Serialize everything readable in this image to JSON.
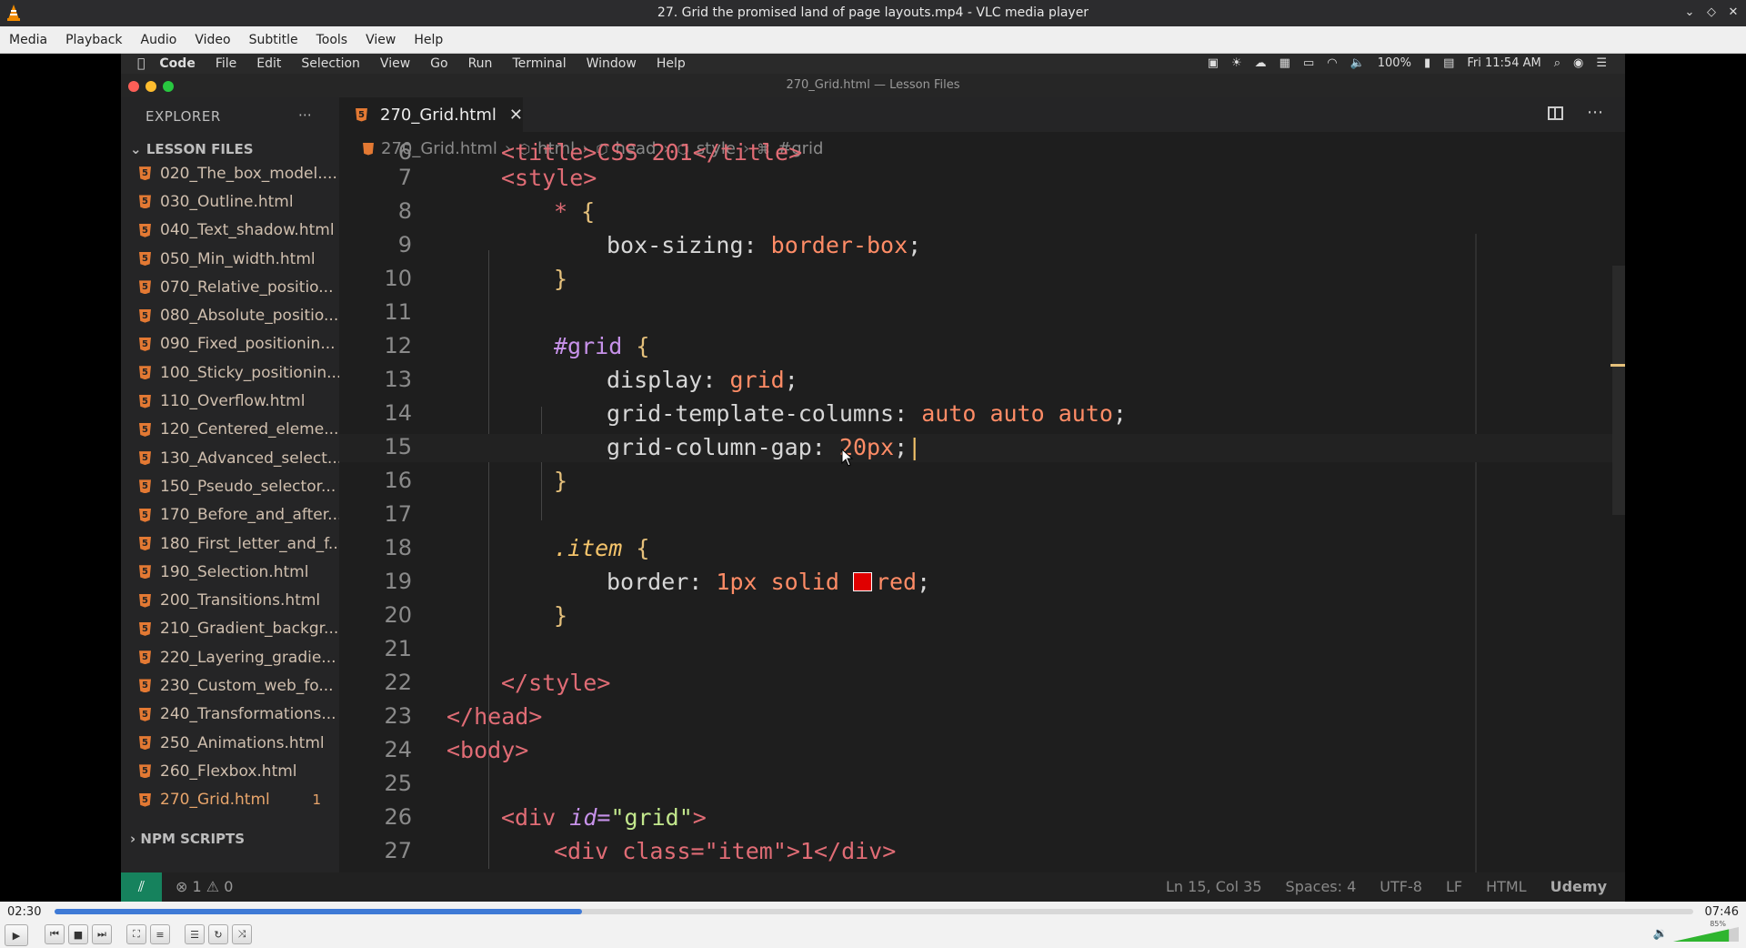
{
  "window": {
    "title": "27. Grid the promised land of page layouts.mp4 - VLC media player",
    "buttons": [
      "minimize",
      "restore",
      "close"
    ]
  },
  "vlc_menu": [
    "Media",
    "Playback",
    "Audio",
    "Video",
    "Subtitle",
    "Tools",
    "View",
    "Help"
  ],
  "player": {
    "elapsed": "02:30",
    "total": "07:46",
    "progress_fraction": 0.322,
    "volume_label": "85%",
    "volume_fraction": 0.85
  },
  "video": {
    "mac_menu": [
      "Code",
      "File",
      "Edit",
      "Selection",
      "View",
      "Go",
      "Run",
      "Terminal",
      "Window",
      "Help"
    ],
    "mac_status": {
      "battery": "100%",
      "clock": "Fri 11:54 AM"
    },
    "vscode_title": "270_Grid.html — Lesson Files",
    "explorer": {
      "header": "EXPLORER",
      "section": "LESSON FILES",
      "files": [
        "020_The_box_model....",
        "030_Outline.html",
        "040_Text_shadow.html",
        "050_Min_width.html",
        "070_Relative_positio...",
        "080_Absolute_positio...",
        "090_Fixed_positionin...",
        "100_Sticky_positionin...",
        "110_Overflow.html",
        "120_Centered_eleme...",
        "130_Advanced_select...",
        "150_Pseudo_selector...",
        "170_Before_and_after...",
        "180_First_letter_and_f...",
        "190_Selection.html",
        "200_Transitions.html",
        "210_Gradient_backgr...",
        "220_Layering_gradie...",
        "230_Custom_web_fo...",
        "240_Transformations...",
        "250_Animations.html",
        "260_Flexbox.html",
        "270_Grid.html"
      ],
      "active_badge": "1",
      "npm": "NPM SCRIPTS"
    },
    "tab": {
      "label": "270_Grid.html"
    },
    "breadcrumb": [
      "270_Grid.html",
      "html",
      "head",
      "style",
      "#grid"
    ],
    "line_numbers": [
      "6",
      "7",
      "8",
      "9",
      "10",
      "11",
      "12",
      "13",
      "14",
      "15",
      "16",
      "17",
      "18",
      "19",
      "20",
      "21",
      "22",
      "23",
      "24",
      "25",
      "26",
      "27"
    ],
    "code": {
      "l6": "<title>CSS 201</title>",
      "l7": "<style>",
      "l8_sel": "*",
      "l8_brace": "{",
      "l9_prop": "box-sizing:",
      "l9_val": "border-box",
      "l10": "}",
      "l12_sel": "#grid",
      "l12_brace": "{",
      "l13_prop": "display:",
      "l13_val": "grid",
      "l14_prop": "grid-template-columns:",
      "l14_val": "auto auto auto",
      "l15_prop": "grid-column-gap:",
      "l15_val": "20px",
      "l16": "}",
      "l18_sel": ".item",
      "l18_brace": "{",
      "l19_prop": "border:",
      "l19_val": "1px solid",
      "l19_color": "red",
      "l20": "}",
      "l22": "</style>",
      "l23": "</head>",
      "l24": "<body>",
      "l26_open": "<div",
      "l26_attr": "id=",
      "l26_str": "\"grid\"",
      "l26_close": ">",
      "l27": "<div class=\"item\">1</div>"
    },
    "status": {
      "errors": "⊗ 1 ⚠ 0",
      "position": "Ln 15, Col 35",
      "spaces": "Spaces: 4",
      "encoding": "UTF-8",
      "eol": "LF",
      "language": "HTML",
      "brand": "Udemy"
    }
  },
  "colors": {
    "seek_fill": "#3e7ad6",
    "tag": "#e06c75",
    "selector": "#c792ea",
    "value": "#ff8c66",
    "html_icon": "#e37933",
    "remote_status": "#16825d"
  }
}
